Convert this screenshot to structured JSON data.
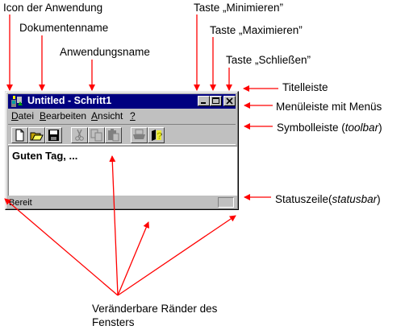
{
  "annotations": {
    "icon": "Icon der Anwendung",
    "document_name": "Dokumentenname",
    "app_name": "Anwendungsname",
    "minimize": "Taste „Minimieren”",
    "maximize": "Taste „Maximieren”",
    "close": "Taste „Schließen”",
    "titlebar": "Titelleiste",
    "menubar": "Menüleiste mit Menüs",
    "toolbar_prefix": "Symbolleiste (",
    "toolbar_italic": "toolbar",
    "toolbar_suffix": ")",
    "statusbar_prefix": "Statuszeile(",
    "statusbar_italic": "statusbar",
    "statusbar_suffix": ")",
    "borders_line1": "Veränderbare Ränder des",
    "borders_line2": "Fensters"
  },
  "window": {
    "title": "Untitled - Schritt1",
    "menus": [
      {
        "label": "Datei",
        "accel": "D",
        "rest": "atei"
      },
      {
        "label": "Bearbeiten",
        "accel": "B",
        "rest": "earbeiten"
      },
      {
        "label": "Ansicht",
        "accel": "A",
        "rest": "nsicht"
      },
      {
        "label": "?",
        "accel": "?",
        "rest": ""
      }
    ],
    "toolbar_icons": [
      "new-icon",
      "open-icon",
      "save-icon",
      "cut-icon",
      "copy-icon",
      "paste-icon",
      "print-icon",
      "help-icon"
    ],
    "content_text": "Guten Tag, ...",
    "status_text": "Bereit"
  },
  "colors": {
    "annotation_lines": "#ff0000",
    "titlebar": "#000080",
    "window_face": "#c0c0c0"
  }
}
